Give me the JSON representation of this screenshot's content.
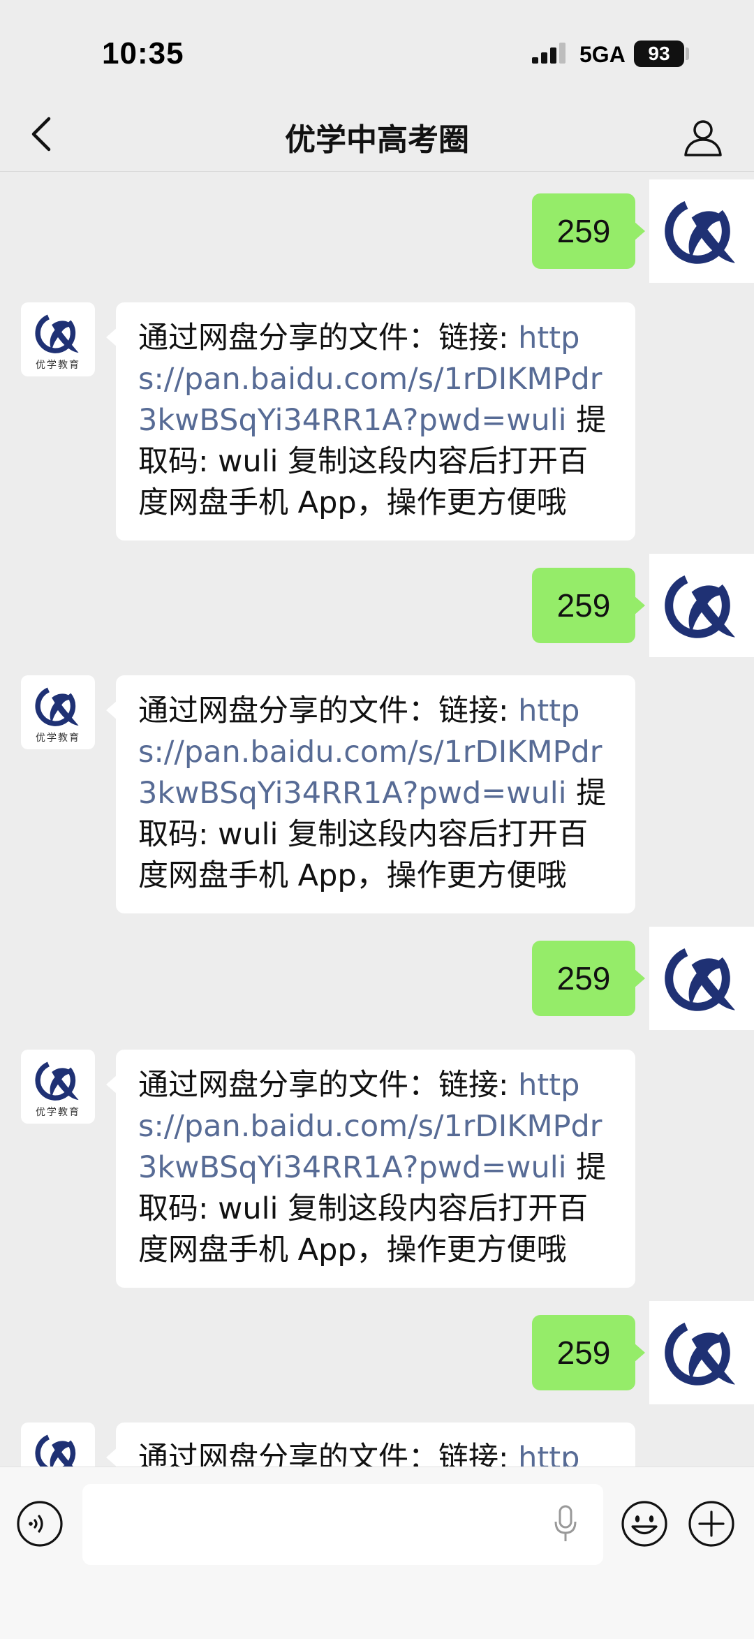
{
  "status_bar": {
    "time": "10:35",
    "network": "5GA",
    "battery": "93"
  },
  "header": {
    "title": "优学中高考圈",
    "back_icon": "chevron-left-icon",
    "profile_icon": "person-icon"
  },
  "avatar_caption": "优学教育",
  "messages": [
    {
      "side": "self",
      "text": "259"
    },
    {
      "side": "other",
      "text_before": "通过网盘分享的文件：链接: ",
      "link": "https://pan.baidu.com/s/1rDIKMPdr3kwBSqYi34RR1A?pwd=wuli",
      "text_after": " 提取码: wuli 复制这段内容后打开百度网盘手机 App，操作更方便哦"
    },
    {
      "side": "self",
      "text": "259"
    },
    {
      "side": "other",
      "text_before": "通过网盘分享的文件：链接: ",
      "link": "https://pan.baidu.com/s/1rDIKMPdr3kwBSqYi34RR1A?pwd=wuli",
      "text_after": " 提取码: wuli 复制这段内容后打开百度网盘手机 App，操作更方便哦"
    },
    {
      "side": "self",
      "text": "259"
    },
    {
      "side": "other",
      "text_before": "通过网盘分享的文件：链接: ",
      "link": "https://pan.baidu.com/s/1rDIKMPdr3kwBSqYi34RR1A?pwd=wuli",
      "text_after": " 提取码: wuli 复制这段内容后打开百度网盘手机 App，操作更方便哦"
    },
    {
      "side": "self",
      "text": "259"
    },
    {
      "side": "other",
      "text_before": "通过网盘分享的文件：链接: ",
      "link": "http",
      "text_after": ""
    }
  ],
  "input_bar": {
    "voice_icon": "voice-icon",
    "mic_icon": "microphone-icon",
    "emoji_icon": "emoji-icon",
    "plus_icon": "plus-icon"
  },
  "colors": {
    "background": "#ededed",
    "self_bubble": "#95ec69",
    "link": "#576b95",
    "logo": "#1f3174"
  }
}
